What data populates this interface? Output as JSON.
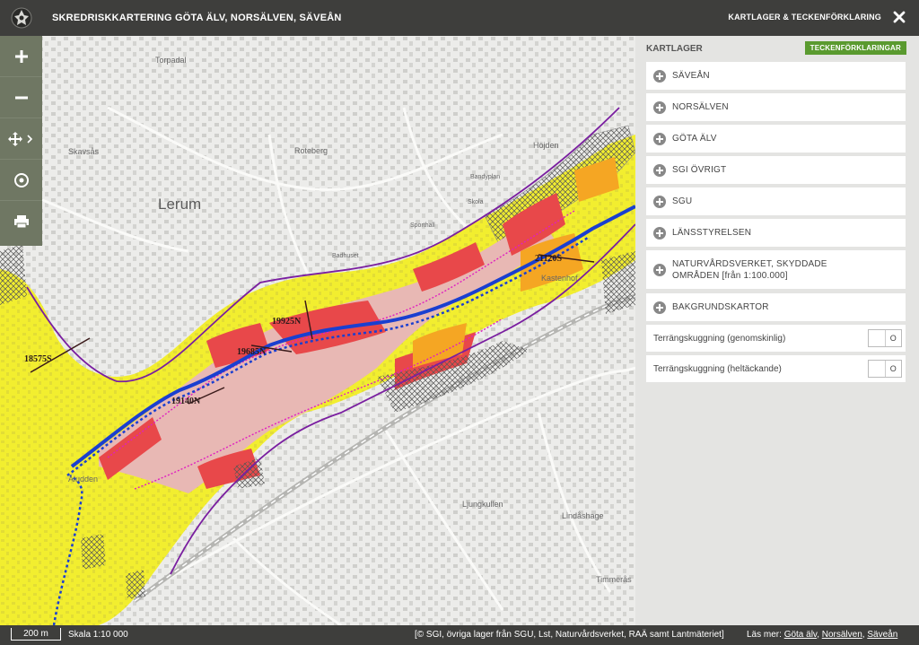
{
  "header": {
    "title": "SKREDRISKKARTERING GÖTA ÄLV, NORSÄLVEN, SÄVEÅN",
    "layers_toggle_label": "KARTLAGER & TECKENFÖRKLARING",
    "close_icon": "close-icon",
    "logo_icon": "agency-crest-icon"
  },
  "toolbar": {
    "tools": [
      {
        "name": "zoom-in",
        "icon": "plus-icon"
      },
      {
        "name": "zoom-out",
        "icon": "minus-icon"
      },
      {
        "name": "pan",
        "icon": "move-arrows-icon"
      },
      {
        "name": "locate",
        "icon": "target-icon"
      },
      {
        "name": "print",
        "icon": "printer-icon"
      }
    ]
  },
  "map": {
    "place_labels": [
      "Torpadal",
      "Skavsås",
      "Lerum",
      "Roteberg",
      "Höjden",
      "Bandyplan",
      "Skola",
      "Sporthall",
      "Badhuset",
      "Kastenhof",
      "Aludden",
      "Ljungkullen",
      "Lindåshage",
      "Timmerås"
    ],
    "section_labels": [
      "18575S",
      "19140N",
      "19685N",
      "19925N",
      "21120S"
    ],
    "colors": {
      "water": "#a8d3ee",
      "yellow_zone": "#f2ee2f",
      "pink_zone": "#e8b8b4",
      "red_zone": "#e8484a",
      "orange_zone": "#f5a623",
      "boundary_purple": "#7a1fa0",
      "river_blue": "#1a3fd0"
    }
  },
  "panel": {
    "heading": "KARTLAGER",
    "legend_button": "TECKENFÖRKLARINGAR",
    "layers": [
      {
        "label": "SÄVEÅN"
      },
      {
        "label": "NORSÄLVEN"
      },
      {
        "label": "GÖTA ÄLV"
      },
      {
        "label": "SGI ÖVRIGT"
      },
      {
        "label": "SGU"
      },
      {
        "label": "LÄNSSTYRELSEN"
      },
      {
        "label_line1": "NATURVÅRDSVERKET, SKYDDADE",
        "label_line2": "OMRÅDEN [från 1:100.000]"
      },
      {
        "label": "BAKGRUNDSKARTOR"
      }
    ],
    "toggles": [
      {
        "label": "Terrängskuggning (genomskinlig)",
        "state": "O"
      },
      {
        "label": "Terrängskuggning (heltäckande)",
        "state": "O"
      }
    ]
  },
  "footer": {
    "scale_bar": "200 m",
    "scale_text": "Skala 1:10 000",
    "attribution": "[© SGI, övriga lager från SGU, Lst, Naturvårdsverket, RAÄ samt Lantmäteriet]",
    "read_more_prefix": "Läs mer:",
    "links": [
      "Göta älv",
      "Norsälven",
      "Säveån"
    ]
  }
}
